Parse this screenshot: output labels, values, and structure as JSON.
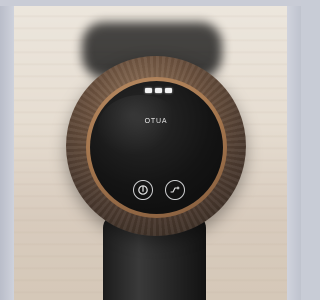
{
  "device": {
    "brand_label": "OTUA",
    "indicator_lights": 3,
    "buttons": [
      {
        "name": "power",
        "icon": "power-icon"
      },
      {
        "name": "mode",
        "icon": "mode-icon"
      }
    ]
  },
  "colors": {
    "frame": "#c8ccd6",
    "wall": "#e6ddd1",
    "ring": "#6b513e",
    "bezel": "#a7784f",
    "screen": "#141414"
  }
}
